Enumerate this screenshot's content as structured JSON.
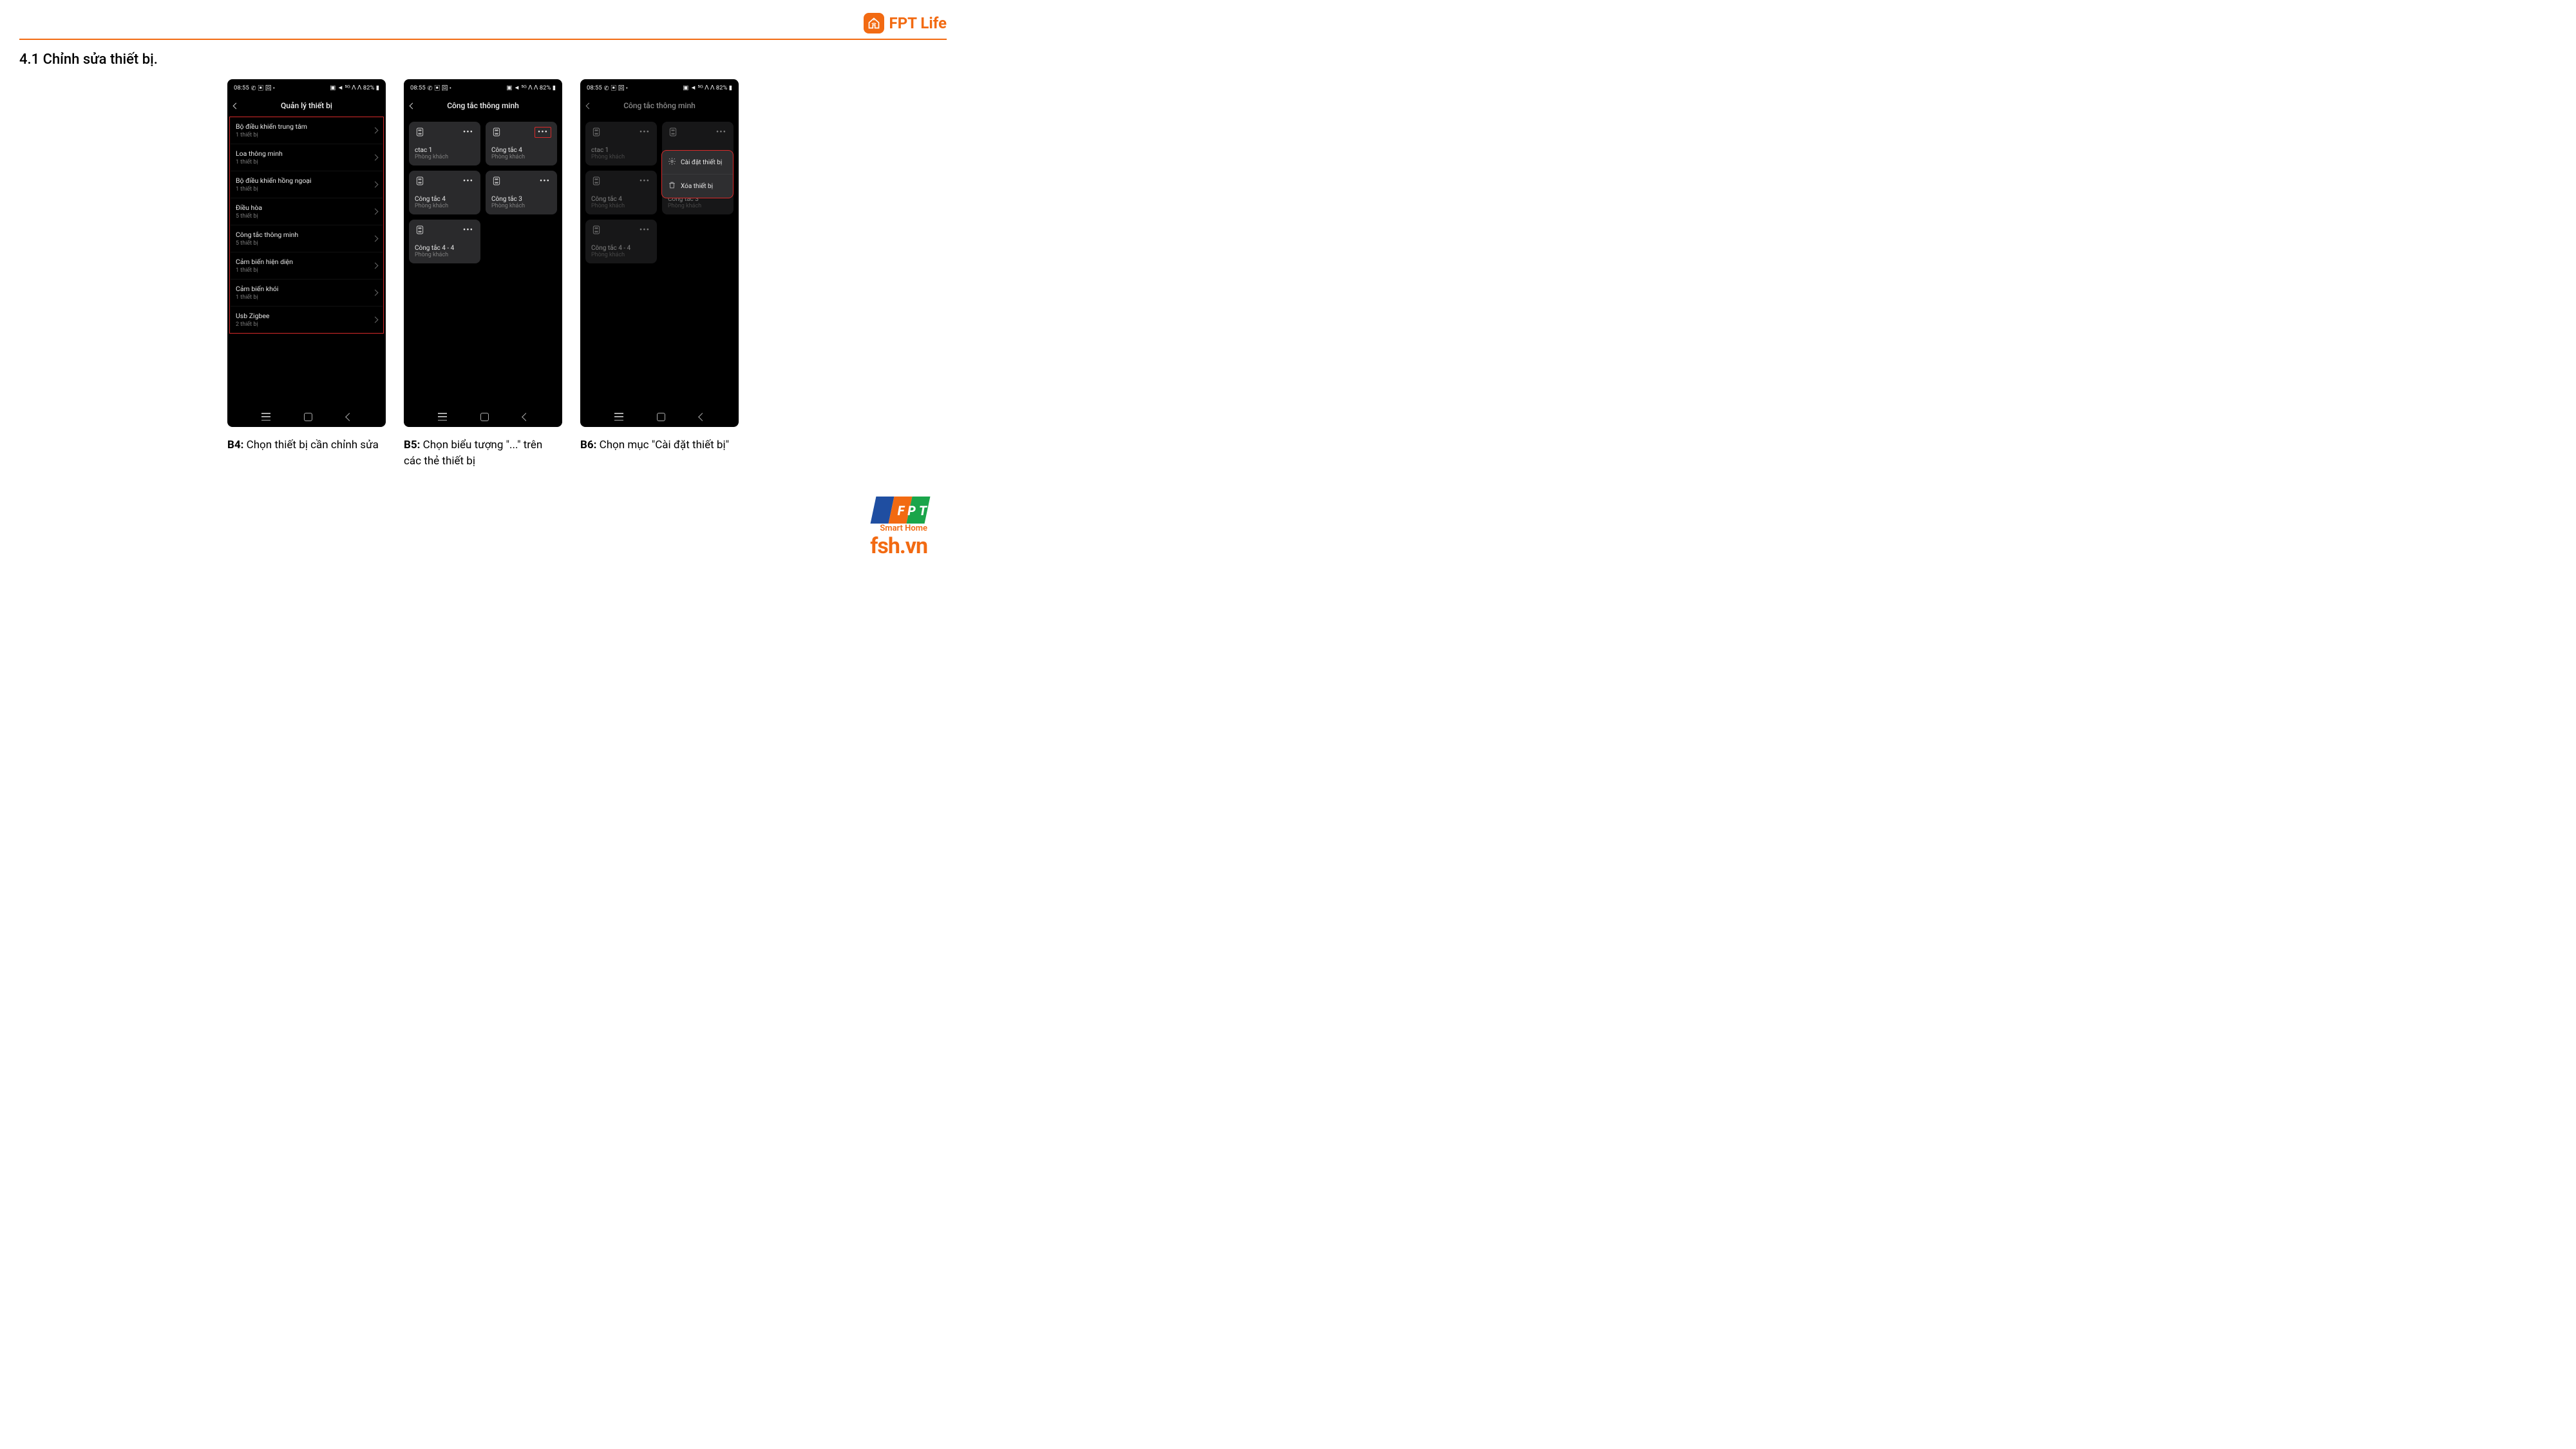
{
  "brand": {
    "name": "FPT Life"
  },
  "section_title": "4.1 Chỉnh sửa thiết bị.",
  "status_bar": {
    "time": "08:55",
    "left_icons": "✆ ▣ 回 •",
    "right": "▣ ◄ ⁵ᴳ ᐱ ᐱ 82% ▮"
  },
  "android_nav": {
    "recent": "recent",
    "home": "home",
    "back": "back"
  },
  "screen1": {
    "title": "Quản lý thiết bị",
    "rows": [
      {
        "name": "Bộ điều khiển trung tâm",
        "sub": "1 thiết bị"
      },
      {
        "name": "Loa thông minh",
        "sub": "1 thiết bị"
      },
      {
        "name": "Bộ điều khiển hồng ngoại",
        "sub": "1 thiết bị"
      },
      {
        "name": "Điều hòa",
        "sub": "5 thiết bị"
      },
      {
        "name": "Công tắc thông minh",
        "sub": "5 thiết bị"
      },
      {
        "name": "Cảm biến hiện diện",
        "sub": "1 thiết bị"
      },
      {
        "name": "Cảm biến khói",
        "sub": "1 thiết bị"
      },
      {
        "name": "Usb Zigbee",
        "sub": "2 thiết bị"
      }
    ]
  },
  "screen2": {
    "title": "Công tắc thông minh",
    "cards": [
      {
        "name": "ctac 1",
        "sub": "Phòng khách",
        "highlight_dots": false
      },
      {
        "name": "Công tắc 4",
        "sub": "Phòng khách",
        "highlight_dots": true
      },
      {
        "name": "Công tắc 4",
        "sub": "Phòng khách",
        "highlight_dots": false
      },
      {
        "name": "Công tắc 3",
        "sub": "Phòng khách",
        "highlight_dots": false
      },
      {
        "name": "Công tắc 4 - 4",
        "sub": "Phòng khách",
        "highlight_dots": false
      }
    ]
  },
  "screen3": {
    "title": "Công tắc thông minh",
    "cards": [
      {
        "name": "ctac 1",
        "sub": "Phòng khách"
      },
      {
        "name": "",
        "sub": ""
      },
      {
        "name": "Công tắc 4",
        "sub": "Phòng khách"
      },
      {
        "name": "Công tắc 3",
        "sub": "Phòng khách"
      },
      {
        "name": "Công tắc 4 - 4",
        "sub": "Phòng khách"
      }
    ],
    "menu": {
      "settings": "Cài đặt thiết bị",
      "delete": "Xóa thiết bị"
    }
  },
  "captions": {
    "b4_prefix": "B4:",
    "b4_text": " Chọn thiết bị cần chỉnh sửa",
    "b5_prefix": "B5:",
    "b5_text": " Chọn biểu tượng \"...\" trên các thẻ thiết bị",
    "b6_prefix": "B6:",
    "b6_text": " Chọn mục \"Cài đặt thiết bị\""
  },
  "footer": {
    "smart_home": "Smart Home",
    "url": "fsh.vn"
  },
  "icons": {
    "switch": "switch-icon",
    "gear": "gear-icon",
    "trash": "trash-icon",
    "house": "house-icon",
    "dots": "•••"
  }
}
